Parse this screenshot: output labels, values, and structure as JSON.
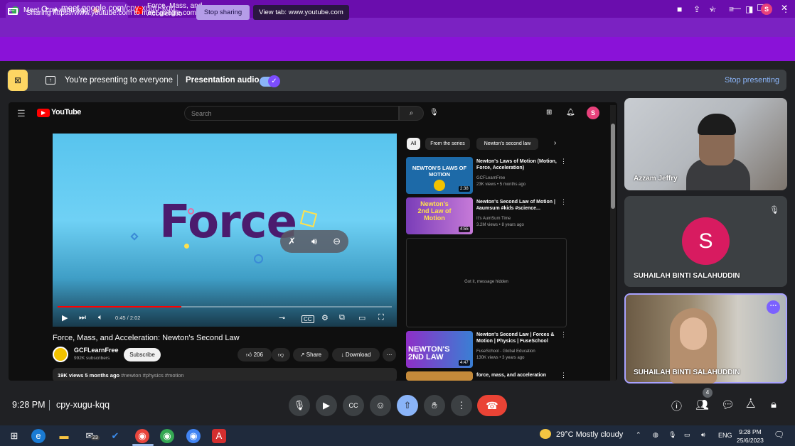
{
  "browser": {
    "tabs": [
      {
        "title": "Meet - cpy-xugu-kqq",
        "active": true
      },
      {
        "title": "Force, Mass, and Acceleratio",
        "active": false
      }
    ],
    "new_tab": "+",
    "url_host": "meet.google.com",
    "url_path": "/cpy-xugu-kqq",
    "profile_initial": "S"
  },
  "share_bar": {
    "text": "Sharing https://www.youtube.com to meet.google.com",
    "stop_label": "Stop sharing",
    "view_tab_label": "View tab: www.youtube.com"
  },
  "presenting": {
    "text": "You're presenting to everyone",
    "audio_label": "Presentation audio",
    "audio_enabled": true,
    "stop_label": "Stop presenting"
  },
  "youtube": {
    "logo_text": "YouTube",
    "search_placeholder": "Search",
    "avatar_initial": "S",
    "player": {
      "slide_word": "Force",
      "time": "0:45 / 2:02",
      "progress": 0.37
    },
    "video_title": "Force, Mass, and Acceleration: Newton's Second Law",
    "channel_name": "GCFLearnFree",
    "channel_subs": "992K subscribers",
    "subscribe_label": "Subscribe",
    "like_count": "206",
    "share_label": "Share",
    "download_label": "Download",
    "description_meta": "19K views  5 months ago",
    "description_tags": "#newton #physics #motion",
    "chips": [
      "All",
      "From the series",
      "Newton's second law"
    ],
    "recommendations": [
      {
        "title": "Newton's Laws of Motion (Motion, Force, Acceleration)",
        "channel": "GCFLearnFree",
        "meta": "23K views • 5 months ago",
        "duration": "2:38",
        "thumb_text": "NEWTON'S LAWS OF MOTION"
      },
      {
        "title": "Newton's Second Law of Motion | #aumsum #kids #science...",
        "channel": "It's AumSum Time",
        "meta": "3.2M views • 8 years ago",
        "duration": "4:55",
        "thumb_text": "Newton's 2nd Law of Motion"
      },
      {
        "title": "Newton's Second Law | Forces & Motion | Physics | FuseSchool",
        "channel": "FuseSchool - Global Education",
        "meta": "130K views • 3 years ago",
        "duration": "4:47",
        "thumb_text": "NEWTON'S 2ND LAW"
      },
      {
        "title": "force, mass, and acceleration",
        "channel": "",
        "meta": "",
        "duration": "",
        "thumb_text": ""
      }
    ],
    "hidden_message": "Got it, message hidden"
  },
  "participants": [
    {
      "name": "Azzam Jeffry"
    },
    {
      "name": "SUHAILAH BINTI SALAHUDDIN",
      "initial": "S",
      "muted": true
    },
    {
      "name": "SUHAILAH BINTI SALAHUDDIN"
    }
  ],
  "meeting": {
    "time": "9:28 PM",
    "code": "cpy-xugu-kqq",
    "people_count": "4"
  },
  "taskbar": {
    "weather": "29°C  Mostly cloudy",
    "lang": "ENG",
    "time": "9:28 PM",
    "date": "25/6/2023",
    "badge_mail": "23"
  }
}
